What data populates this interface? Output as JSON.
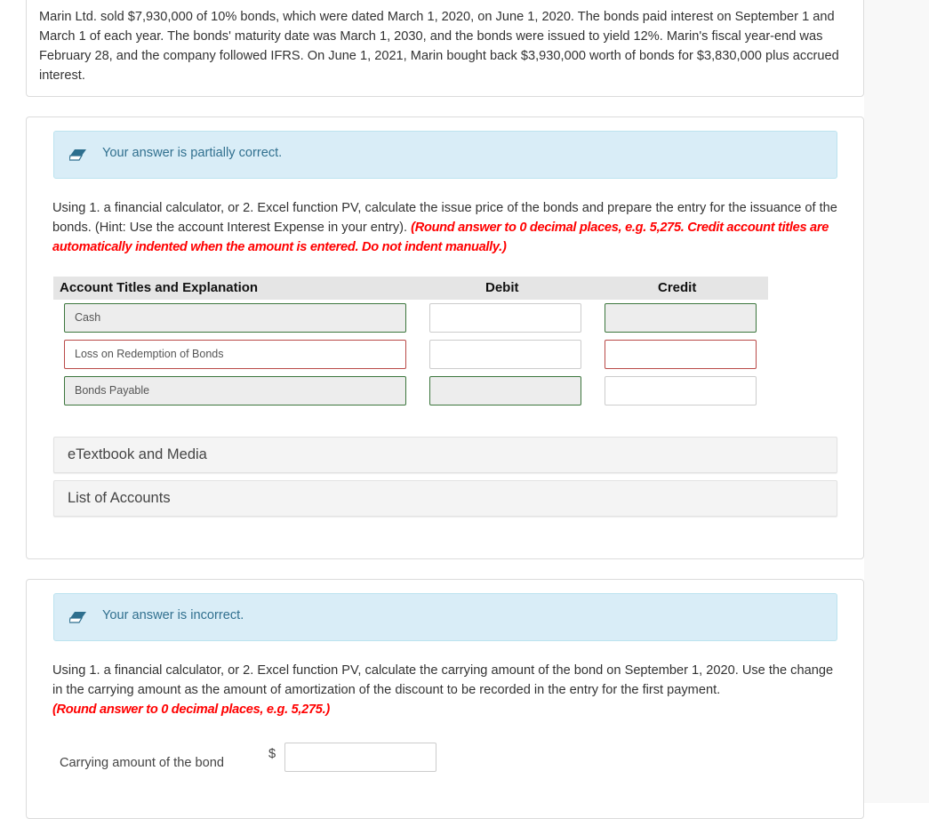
{
  "problem": {
    "text": "Marin Ltd. sold $7,930,000 of 10% bonds, which were dated March 1, 2020, on June 1, 2020. The bonds paid interest on September 1 and March 1 of each year. The bonds' maturity date was March 1, 2030, and the bonds were issued to yield 12%. Marin's fiscal year-end was February 28, and the company followed IFRS. On June 1, 2021, Marin bought back $3,930,000 worth of bonds for $3,830,000 plus accrued interest."
  },
  "part1": {
    "feedback": {
      "icon": "eraser-icon",
      "message": "Your answer is partially correct.",
      "bg_color": "#d9edf7",
      "text_color": "#31708f"
    },
    "instructions": {
      "text": "Using 1. a financial calculator, or 2. Excel function PV, calculate the issue price of the bonds and prepare the entry for the issuance of the bonds. (Hint:  Use the account Interest Expense in your entry). ",
      "red_text": "(Round answer to 0 decimal places, e.g. 5,275. Credit account titles are automatically indented when the amount is entered. Do not indent manually.)"
    },
    "table": {
      "headers": {
        "account": "Account Titles and Explanation",
        "debit": "Debit",
        "credit": "Credit"
      },
      "rows": [
        {
          "account": "Cash",
          "account_status": "correct",
          "debit": "",
          "debit_status": "neutral",
          "credit": "",
          "credit_status": "correct"
        },
        {
          "account": "Loss on Redemption of Bonds",
          "account_status": "wrong",
          "debit": "",
          "debit_status": "neutral",
          "credit": "",
          "credit_status": "wrong"
        },
        {
          "account": "Bonds Payable",
          "account_status": "correct",
          "debit": "",
          "debit_status": "correct",
          "credit": "",
          "credit_status": "neutral"
        }
      ]
    },
    "links": {
      "etextbook": "eTextbook and Media",
      "list_of_accounts": "List of Accounts"
    }
  },
  "part2": {
    "feedback": {
      "icon": "eraser-icon",
      "message": "Your answer is incorrect."
    },
    "instructions": {
      "text": "Using 1. a financial calculator, or 2. Excel function PV, calculate the carrying amount of the bond on September 1, 2020. Use the change in the carrying amount as the amount of amortization of the discount to be recorded in the entry for the first payment.",
      "red_text": "(Round answer to 0 decimal places, e.g. 5,275.)"
    },
    "carrying": {
      "label": "Carrying amount of the bond",
      "currency": "$",
      "value": ""
    }
  },
  "colors": {
    "correct_border": "#3c763d",
    "wrong_border": "#b94a48",
    "instruction_red": "#ff0000"
  }
}
